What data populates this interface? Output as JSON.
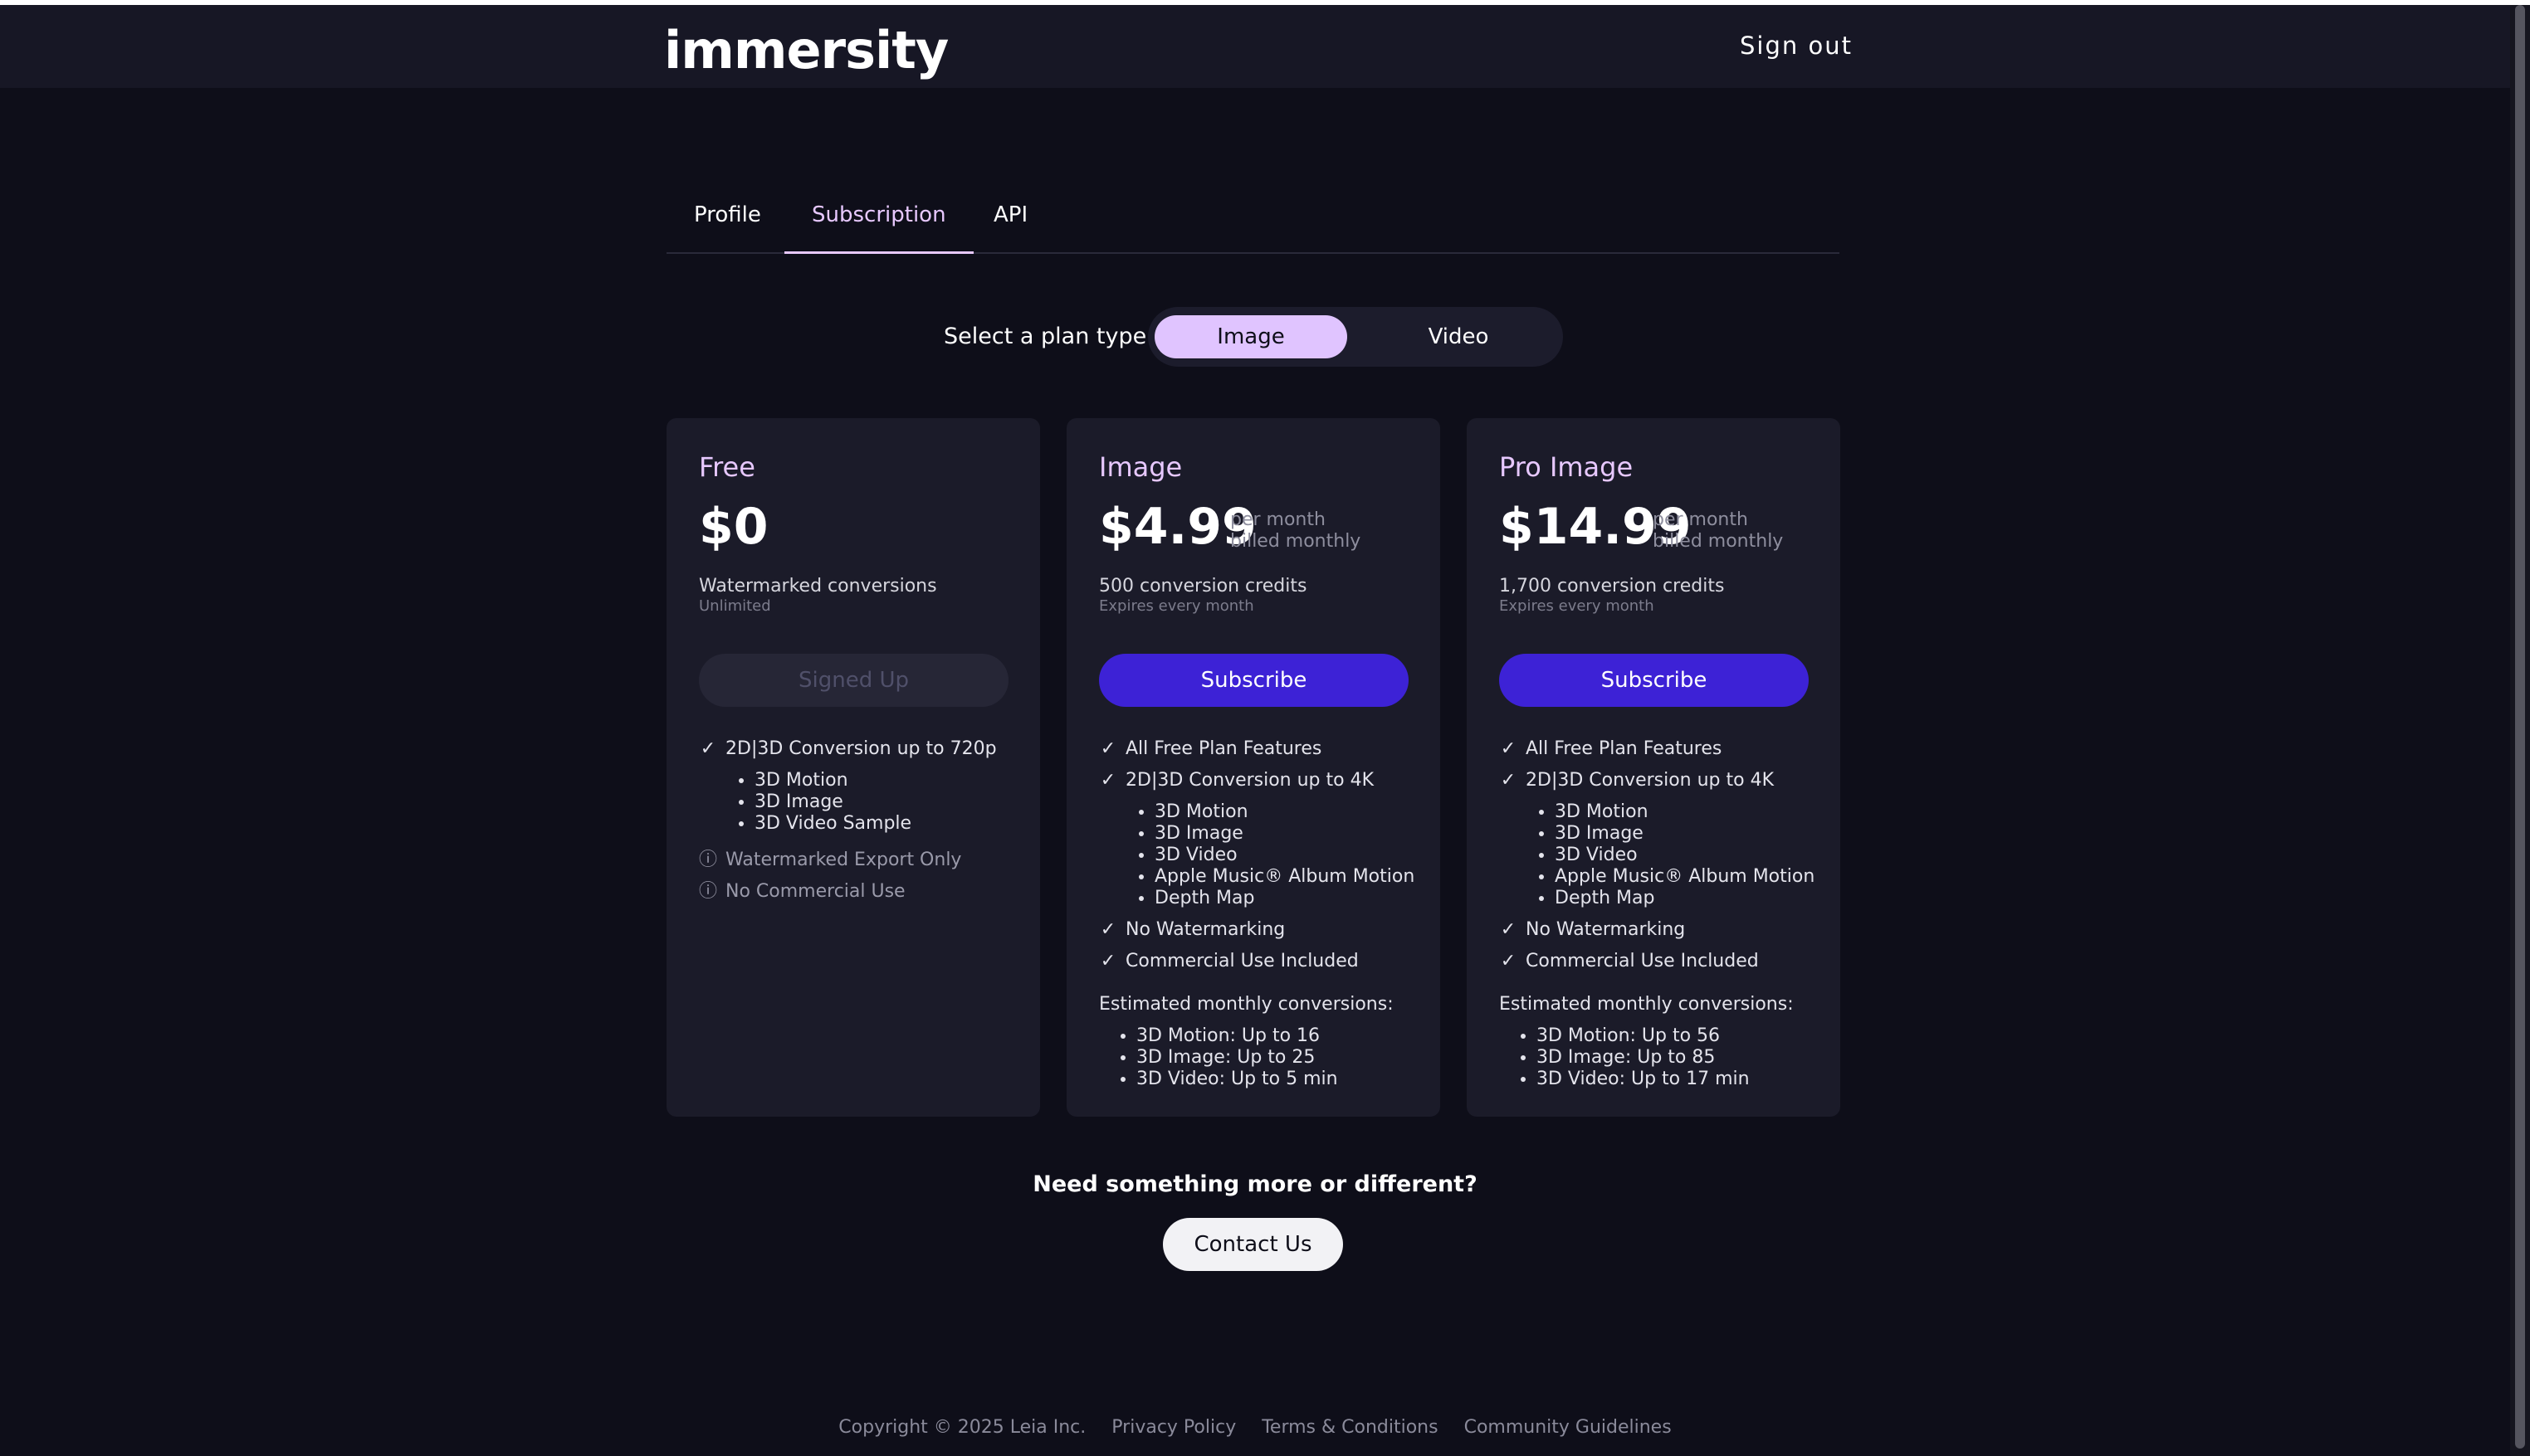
{
  "header": {
    "logo": "immersity",
    "sign_out": "Sign out"
  },
  "tabs": [
    {
      "label": "Profile",
      "active": false
    },
    {
      "label": "Subscription",
      "active": true
    },
    {
      "label": "API",
      "active": false
    }
  ],
  "plan_type": {
    "label": "Select a plan type:",
    "options": [
      "Image",
      "Video"
    ],
    "selected": "Image"
  },
  "plans": [
    {
      "name": "Free",
      "price": "$0",
      "price_note": [
        "",
        ""
      ],
      "credits": "Watermarked conversions",
      "credits_sub": "Unlimited",
      "cta": "Signed Up",
      "features": [
        {
          "icon": "check-icon",
          "text": "2D|3D Conversion up to 720p",
          "bullets": [
            "3D Motion",
            "3D Image",
            "3D Video Sample"
          ]
        },
        {
          "icon": "info-icon",
          "text": "Watermarked Export Only"
        },
        {
          "icon": "info-icon",
          "text": "No Commercial Use"
        }
      ]
    },
    {
      "name": "Image",
      "price": "$4.99",
      "price_note": [
        "per month",
        "billed monthly"
      ],
      "credits": "500 conversion credits",
      "credits_sub": "Expires every month",
      "cta": "Subscribe",
      "features": [
        {
          "icon": "check-icon",
          "text": "All Free Plan Features"
        },
        {
          "icon": "check-icon",
          "text": "2D|3D Conversion up to 4K",
          "bullets": [
            "3D Motion",
            "3D Image",
            "3D Video",
            "Apple Music® Album Motion",
            "Depth Map"
          ]
        },
        {
          "icon": "check-icon",
          "text": "No Watermarking"
        },
        {
          "icon": "check-icon",
          "text": "Commercial Use Included"
        }
      ],
      "estimates_title": "Estimated monthly conversions:",
      "estimates": [
        "3D Motion: Up to 16",
        "3D Image: Up to 25",
        "3D Video: Up to 5 min"
      ]
    },
    {
      "name": "Pro Image",
      "price": "$14.99",
      "price_note": [
        "per month",
        "billed monthly"
      ],
      "credits": "1,700 conversion credits",
      "credits_sub": "Expires every month",
      "cta": "Subscribe",
      "features": [
        {
          "icon": "check-icon",
          "text": "All Free Plan Features"
        },
        {
          "icon": "check-icon",
          "text": "2D|3D Conversion up to 4K",
          "bullets": [
            "3D Motion",
            "3D Image",
            "3D Video",
            "Apple Music® Album Motion",
            "Depth Map"
          ]
        },
        {
          "icon": "check-icon",
          "text": "No Watermarking"
        },
        {
          "icon": "check-icon",
          "text": "Commercial Use Included"
        }
      ],
      "estimates_title": "Estimated monthly conversions:",
      "estimates": [
        "3D Motion: Up to 56",
        "3D Image: Up to 85",
        "3D Video: Up to 17 min"
      ]
    }
  ],
  "more": {
    "question": "Need something more or different?",
    "contact": "Contact Us"
  },
  "footer": {
    "copyright": "Copyright © 2025 Leia Inc.",
    "links": [
      "Privacy Policy",
      "Terms & Conditions",
      "Community Guidelines"
    ]
  },
  "colors": {
    "background": "#0e0e19",
    "card": "#1b1b29",
    "accent": "#3d22d6",
    "highlight": "#e0c4ff"
  }
}
